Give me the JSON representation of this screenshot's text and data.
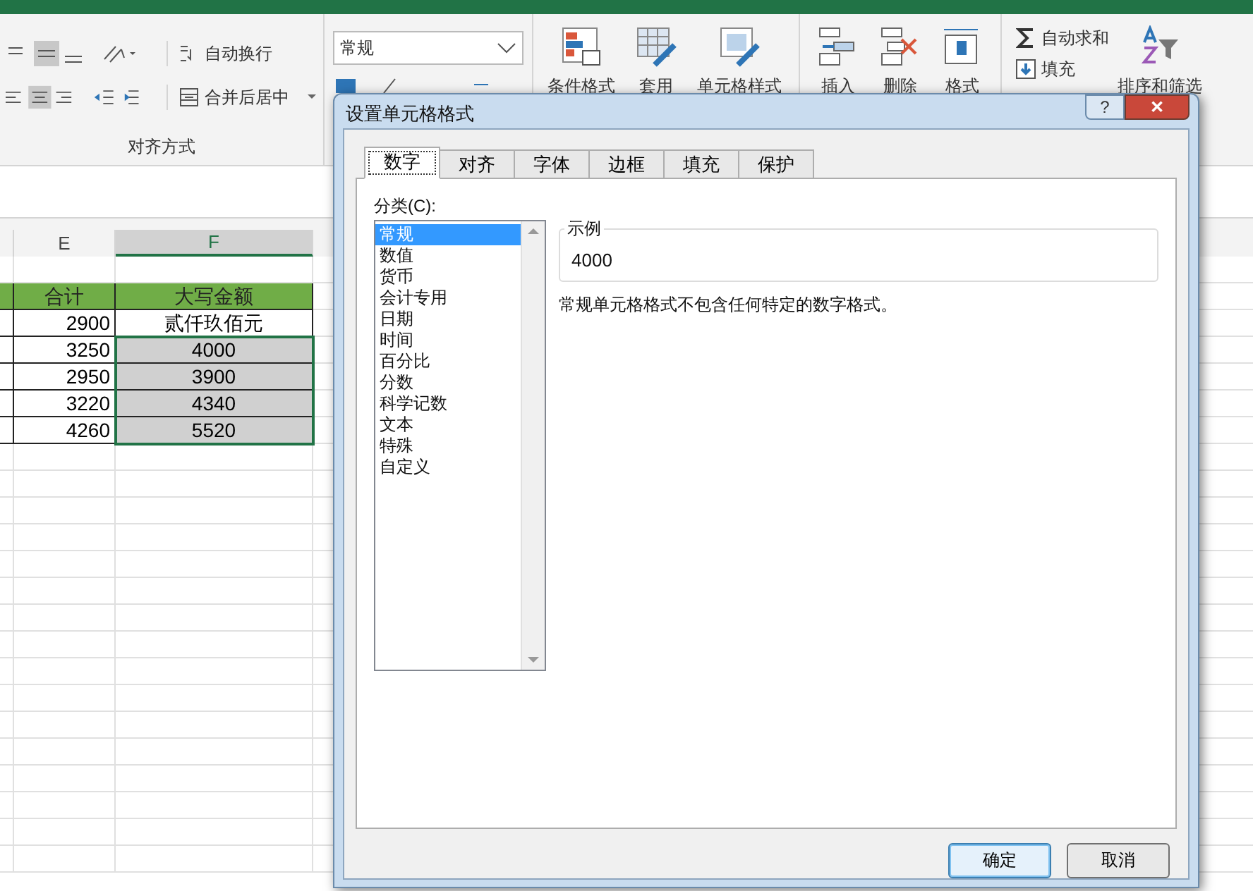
{
  "ribbon": {
    "wrap_text": "自动换行",
    "merge_center": "合并后居中",
    "alignment_group": "对齐方式",
    "number_format": "常规",
    "big_buttons": [
      {
        "label": "条件格式",
        "kind": "cond"
      },
      {
        "label": "套用",
        "kind": "table"
      },
      {
        "label": "单元格样式",
        "kind": "style"
      },
      {
        "label": "插入",
        "kind": "insert"
      },
      {
        "label": "删除",
        "kind": "delete"
      },
      {
        "label": "格式",
        "kind": "format"
      }
    ],
    "autosum": "自动求和",
    "fill": "填充",
    "sort_filter": "排序和筛选"
  },
  "sheet": {
    "columns": [
      {
        "label": "E",
        "selected": false
      },
      {
        "label": "F",
        "selected": true
      }
    ],
    "rows": [
      {
        "cells": [
          "",
          ""
        ],
        "kind": "blank"
      },
      {
        "cells": [
          "合计",
          "大写金额"
        ],
        "kind": "header"
      },
      {
        "cells": [
          "2900",
          "贰仟玖佰元"
        ],
        "kind": "data",
        "selected": false
      },
      {
        "cells": [
          "3250",
          "4000"
        ],
        "kind": "data",
        "selected": true
      },
      {
        "cells": [
          "2950",
          "3900"
        ],
        "kind": "data",
        "selected": true
      },
      {
        "cells": [
          "3220",
          "4340"
        ],
        "kind": "data",
        "selected": true
      },
      {
        "cells": [
          "4260",
          "5520"
        ],
        "kind": "data",
        "selected": true
      }
    ]
  },
  "dialog": {
    "title": "设置单元格格式",
    "help": "?",
    "close": "✕",
    "tabs": [
      {
        "label": "数字",
        "selected": true
      },
      {
        "label": "对齐",
        "selected": false
      },
      {
        "label": "字体",
        "selected": false
      },
      {
        "label": "边框",
        "selected": false
      },
      {
        "label": "填充",
        "selected": false
      },
      {
        "label": "保护",
        "selected": false
      }
    ],
    "category_label": "分类(C):",
    "categories": [
      {
        "label": "常规",
        "selected": true
      },
      {
        "label": "数值",
        "selected": false
      },
      {
        "label": "货币",
        "selected": false
      },
      {
        "label": "会计专用",
        "selected": false
      },
      {
        "label": "日期",
        "selected": false
      },
      {
        "label": "时间",
        "selected": false
      },
      {
        "label": "百分比",
        "selected": false
      },
      {
        "label": "分数",
        "selected": false
      },
      {
        "label": "科学记数",
        "selected": false
      },
      {
        "label": "文本",
        "selected": false
      },
      {
        "label": "特殊",
        "selected": false
      },
      {
        "label": "自定义",
        "selected": false
      }
    ],
    "sample_label": "示例",
    "sample_value": "4000",
    "description": "常规单元格格式不包含任何特定的数字格式。",
    "buttons": [
      {
        "label": "确定",
        "kind": "default"
      },
      {
        "label": "取消",
        "kind": "normal"
      }
    ]
  }
}
